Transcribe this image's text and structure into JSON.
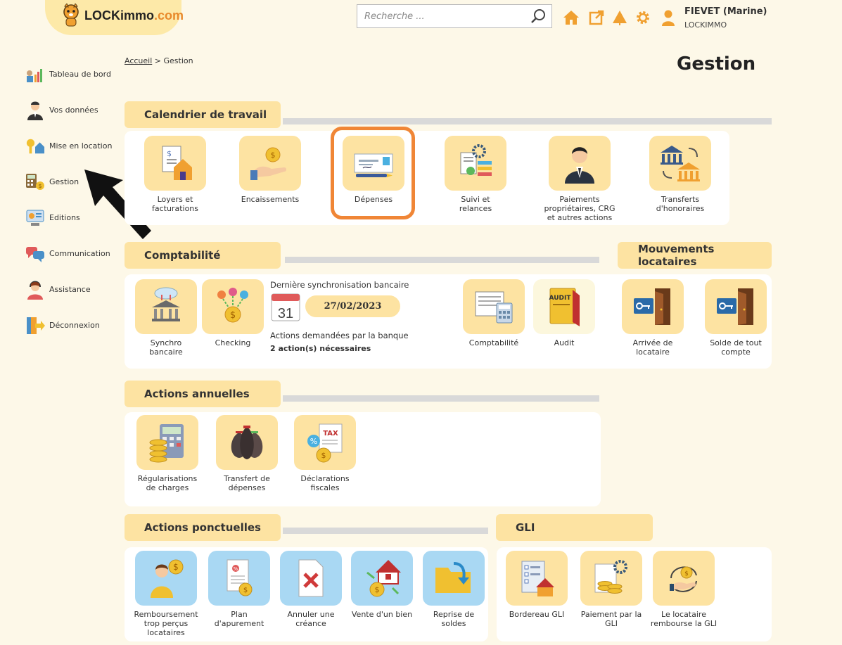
{
  "header": {
    "logo_text": "LOCKimmo",
    "logo_suffix": ".com",
    "search_placeholder": "Recherche ...",
    "icons": [
      "home-icon",
      "external-link-icon",
      "alert-icon",
      "gear-icon",
      "user-icon"
    ],
    "user_name": "FIEVET (Marine)",
    "user_company": "LOCKIMMO"
  },
  "sidebar": {
    "items": [
      {
        "label": "Tableau de bord",
        "icon": "dashboard-icon"
      },
      {
        "label": "Vos données",
        "icon": "person-icon"
      },
      {
        "label": "Mise en location",
        "icon": "key-house-icon"
      },
      {
        "label": "Gestion",
        "icon": "calculator-icon"
      },
      {
        "label": "Editions",
        "icon": "print-icon"
      },
      {
        "label": "Communication",
        "icon": "chat-icon"
      },
      {
        "label": "Assistance",
        "icon": "headset-icon"
      },
      {
        "label": "Déconnexion",
        "icon": "logout-icon"
      }
    ]
  },
  "breadcrumb": {
    "home": "Accueil",
    "separator": ">",
    "current": "Gestion"
  },
  "page_title": "Gestion",
  "sections": {
    "calendrier": {
      "title": "Calendrier de travail",
      "tiles": [
        {
          "label": "Loyers et facturations",
          "icon": "invoice-house-icon"
        },
        {
          "label": "Encaissements",
          "icon": "hand-coin-icon"
        },
        {
          "label": "Dépenses",
          "icon": "cheque-icon"
        },
        {
          "label": "Suivi et relances",
          "icon": "document-gear-icon"
        },
        {
          "label": "Paiements propriétaires, CRG et autres actions",
          "icon": "businessman-icon"
        },
        {
          "label": "Transferts d'honoraires",
          "icon": "bank-transfer-icon"
        }
      ]
    },
    "comptabilite": {
      "title": "Comptabilité",
      "tiles": [
        {
          "label": "Synchro bancaire",
          "icon": "bank-sync-icon"
        },
        {
          "label": "Checking",
          "icon": "checking-icon"
        },
        {
          "label": "Comptabilité",
          "icon": "ledger-calculator-icon"
        },
        {
          "label": "Audit",
          "icon": "audit-folder-icon"
        }
      ],
      "sync_label": "Dernière synchronisation bancaire",
      "calendar_day": "31",
      "sync_date": "27/02/2023",
      "bank_actions_label": "Actions demandées par la banque",
      "bank_actions_count": "2 action(s) nécessaires"
    },
    "mouvements": {
      "title": "Mouvements locataires",
      "tiles": [
        {
          "label": "Arrivée de locataire",
          "icon": "door-key-in-icon"
        },
        {
          "label": "Solde de tout compte",
          "icon": "door-key-out-icon"
        }
      ]
    },
    "annuelles": {
      "title": "Actions annuelles",
      "tiles": [
        {
          "label": "Régularisations de charges",
          "icon": "calculator-coins-icon"
        },
        {
          "label": "Transfert de dépenses",
          "icon": "money-bags-icon"
        },
        {
          "label": "Déclarations fiscales",
          "icon": "tax-document-icon"
        }
      ]
    },
    "ponctuelles": {
      "title": "Actions ponctuelles",
      "tiles": [
        {
          "label": "Remboursement trop perçus locataires",
          "icon": "person-refund-icon"
        },
        {
          "label": "Plan d'apurement",
          "icon": "payment-plan-icon"
        },
        {
          "label": "Annuler une créance",
          "icon": "cancel-document-icon"
        },
        {
          "label": "Vente d'un bien",
          "icon": "house-sale-icon"
        },
        {
          "label": "Reprise de soldes",
          "icon": "folder-arrow-icon"
        }
      ]
    },
    "gli": {
      "title": "GLI",
      "tiles": [
        {
          "label": "Bordereau GLI",
          "icon": "checklist-house-icon"
        },
        {
          "label": "Paiement par la GLI",
          "icon": "document-coins-icon"
        },
        {
          "label": "Le locataire rembourse la GLI",
          "icon": "hand-coin-cycle-icon"
        }
      ]
    }
  },
  "colors": {
    "accent": "#fde3a2",
    "highlight": "#f08636",
    "orange": "#f0a030",
    "background": "#fdf8e8"
  }
}
